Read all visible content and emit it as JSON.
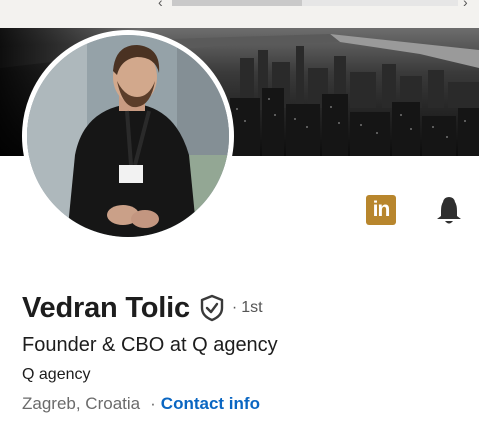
{
  "profile": {
    "name": "Vedran Tolic",
    "degree_separator": "·",
    "degree": "1st",
    "headline": "Founder & CBO at Q agency",
    "company": "Q agency",
    "location": "Zagreb, Croatia",
    "location_separator": "·",
    "contact_info_label": "Contact info"
  },
  "icons": {
    "linkedin": "linkedin-icon",
    "linkedin_glyph": "in",
    "notifications": "bell-icon",
    "verified": "shield-check-icon"
  },
  "colors": {
    "link": "#0a66c2",
    "linkedin_badge": "#b8862d",
    "name_text": "#1d1d1d",
    "muted_text": "#6b6b6b"
  }
}
